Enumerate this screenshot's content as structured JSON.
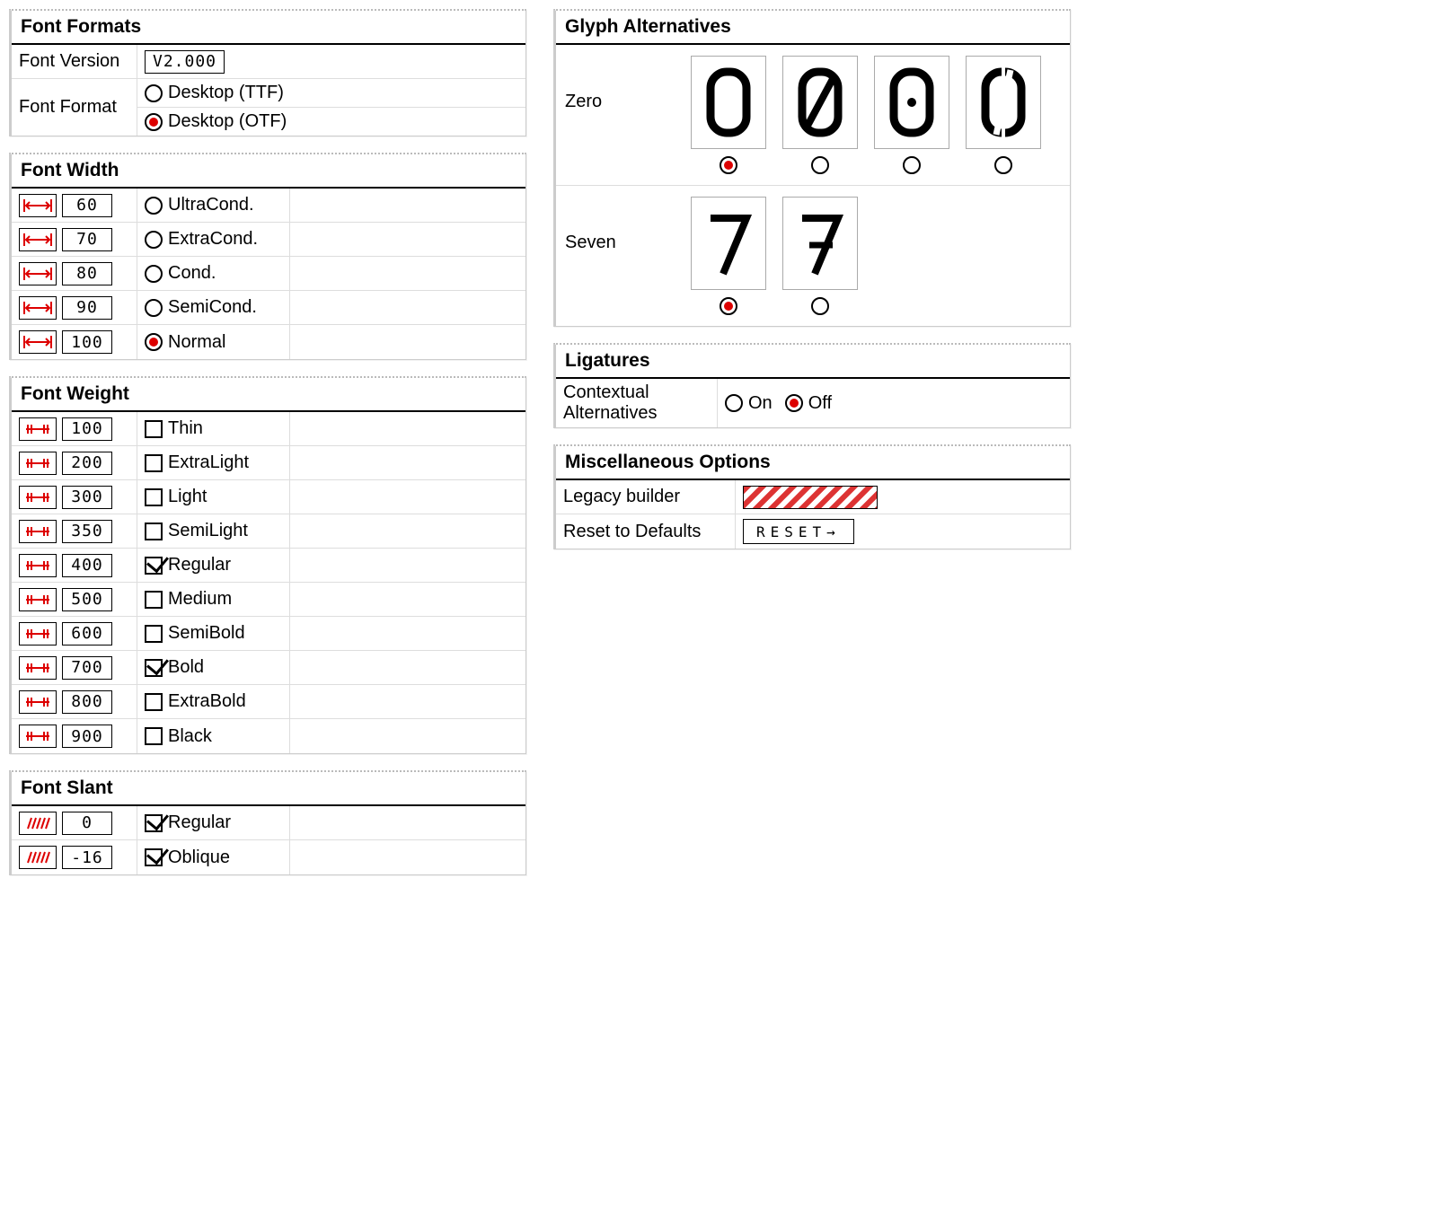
{
  "font_formats": {
    "title": "Font Formats",
    "version_label": "Font Version",
    "version_value": "V2.000",
    "format_label": "Font Format",
    "options": [
      {
        "label": "Desktop (TTF)",
        "selected": false
      },
      {
        "label": "Desktop (OTF)",
        "selected": true
      }
    ]
  },
  "font_width": {
    "title": "Font Width",
    "rows": [
      {
        "value": "60",
        "label": "UltraCond.",
        "selected": false
      },
      {
        "value": "70",
        "label": "ExtraCond.",
        "selected": false
      },
      {
        "value": "80",
        "label": "Cond.",
        "selected": false
      },
      {
        "value": "90",
        "label": "SemiCond.",
        "selected": false
      },
      {
        "value": "100",
        "label": "Normal",
        "selected": true
      }
    ]
  },
  "font_weight": {
    "title": "Font Weight",
    "rows": [
      {
        "value": "100",
        "label": "Thin",
        "checked": false
      },
      {
        "value": "200",
        "label": "ExtraLight",
        "checked": false
      },
      {
        "value": "300",
        "label": "Light",
        "checked": false
      },
      {
        "value": "350",
        "label": "SemiLight",
        "checked": false
      },
      {
        "value": "400",
        "label": "Regular",
        "checked": true
      },
      {
        "value": "500",
        "label": "Medium",
        "checked": false
      },
      {
        "value": "600",
        "label": "SemiBold",
        "checked": false
      },
      {
        "value": "700",
        "label": "Bold",
        "checked": true
      },
      {
        "value": "800",
        "label": "ExtraBold",
        "checked": false
      },
      {
        "value": "900",
        "label": "Black",
        "checked": false
      }
    ]
  },
  "font_slant": {
    "title": "Font Slant",
    "rows": [
      {
        "value": "0",
        "label": "Regular",
        "checked": true
      },
      {
        "value": "-16",
        "label": "Oblique",
        "checked": true
      }
    ]
  },
  "glyph_alt": {
    "title": "Glyph Alternatives",
    "zero_label": "Zero",
    "zero_selected": 0,
    "zero_count": 4,
    "seven_label": "Seven",
    "seven_selected": 0,
    "seven_count": 2
  },
  "ligatures": {
    "title": "Ligatures",
    "row_label": "Contextual Alternatives",
    "on_label": "On",
    "off_label": "Off",
    "value": "off"
  },
  "misc": {
    "title": "Miscellaneous Options",
    "legacy_label": "Legacy builder",
    "reset_label": "Reset to Defaults",
    "reset_button": "RESET→"
  }
}
